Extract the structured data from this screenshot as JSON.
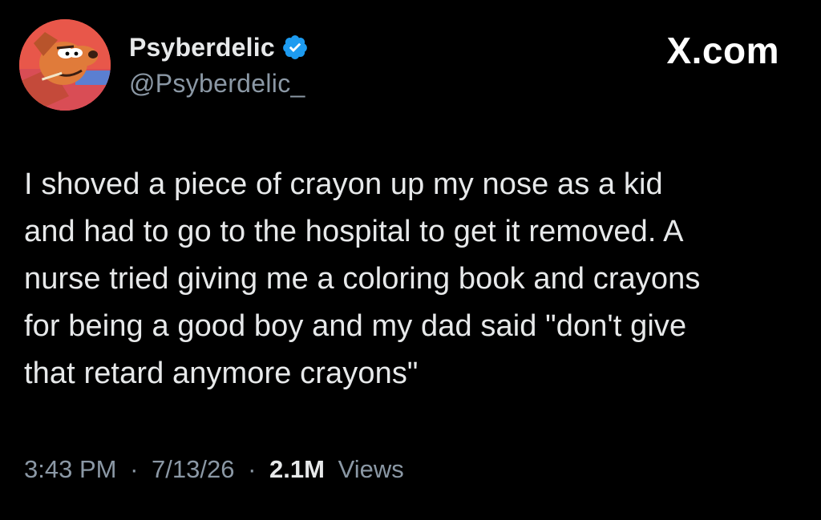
{
  "user": {
    "display_name": "Psyberdelic",
    "handle": "@Psyberdelic_",
    "verified_icon": "verified-badge-icon",
    "avatar_icon": "cartoon-dog-avatar"
  },
  "brand": {
    "label": "X.com"
  },
  "tweet": {
    "lines": [
      "I shoved a piece of crayon up my nose as a kid",
      "and had to go to the hospital to get it removed. A",
      "nurse tried giving me a coloring book and crayons",
      "for being a good boy and my dad said \"don't give",
      "that retard anymore crayons\""
    ]
  },
  "meta": {
    "time": "3:43 PM",
    "separator": "·",
    "date": "7/13/26",
    "views_count": "2.1M",
    "views_label": "Views"
  },
  "colors": {
    "background": "#000000",
    "text": "#e7e9ea",
    "muted": "#8b98a5",
    "verified": "#1d9bf0"
  }
}
